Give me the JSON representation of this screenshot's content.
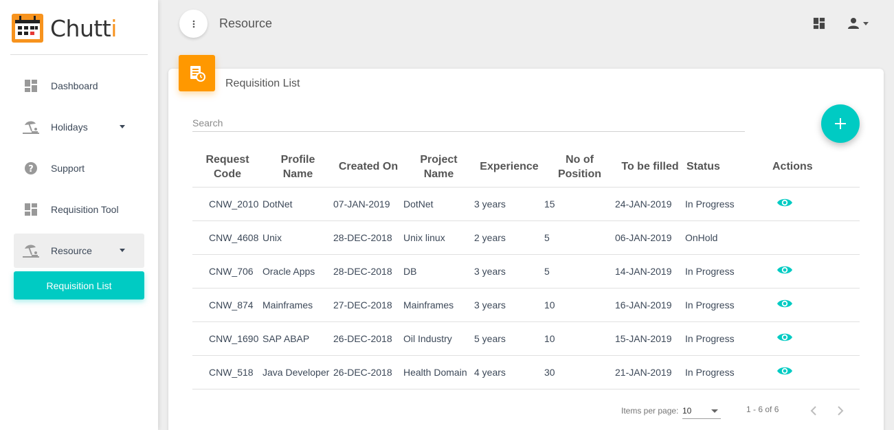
{
  "app": {
    "name_main": "Chutt",
    "name_accent": "i"
  },
  "sidebar": {
    "items": [
      {
        "label": "Dashboard",
        "icon": "dashboard-icon"
      },
      {
        "label": "Holidays",
        "icon": "beach-icon"
      },
      {
        "label": "Support",
        "icon": "help-icon"
      },
      {
        "label": "Requisition Tool",
        "icon": "dashboard-icon"
      },
      {
        "label": "Resource",
        "icon": "beach-icon"
      }
    ],
    "sub_item": "Requisition List"
  },
  "header": {
    "title": "Resource"
  },
  "card": {
    "title": "Requisition List"
  },
  "search": {
    "placeholder": "Search"
  },
  "table": {
    "headers": [
      [
        "Request",
        "Code"
      ],
      [
        "Profile",
        "Name"
      ],
      [
        "Created On"
      ],
      [
        "Project",
        "Name"
      ],
      [
        "Experience"
      ],
      [
        "No of",
        "Position"
      ],
      [
        "To be filled"
      ],
      [
        "Status"
      ],
      [
        "Actions"
      ]
    ],
    "rows": [
      {
        "code": "CNW_2010",
        "profile": "DotNet",
        "created": "07-JAN-2019",
        "project": "DotNet",
        "experience": "3 years",
        "positions": "15",
        "fill_by": "24-JAN-2019",
        "status": "In Progress",
        "view": true
      },
      {
        "code": "CNW_4608",
        "profile": "Unix",
        "created": "28-DEC-2018",
        "project": "Unix linux",
        "experience": "2 years",
        "positions": "5",
        "fill_by": "06-JAN-2019",
        "status": "OnHold",
        "view": false
      },
      {
        "code": "CNW_706",
        "profile": "Oracle Apps",
        "created": "28-DEC-2018",
        "project": "DB",
        "experience": "3 years",
        "positions": "5",
        "fill_by": "14-JAN-2019",
        "status": "In Progress",
        "view": true
      },
      {
        "code": "CNW_874",
        "profile": "Mainframes",
        "created": "27-DEC-2018",
        "project": "Mainframes",
        "experience": "3 years",
        "positions": "10",
        "fill_by": "16-JAN-2019",
        "status": "In Progress",
        "view": true
      },
      {
        "code": "CNW_1690",
        "profile": "SAP ABAP",
        "created": "26-DEC-2018",
        "project": "Oil Industry",
        "experience": "5 years",
        "positions": "10",
        "fill_by": "15-JAN-2019",
        "status": "In Progress",
        "view": true
      },
      {
        "code": "CNW_518",
        "profile": "Java Developer",
        "created": "26-DEC-2018",
        "project": "Health Domain",
        "experience": "4 years",
        "positions": "30",
        "fill_by": "21-JAN-2019",
        "status": "In Progress",
        "view": true
      }
    ]
  },
  "paginator": {
    "label": "Items per page:",
    "page_size": "10",
    "range": "1 - 6 of 6"
  },
  "colors": {
    "accent": "#00cbc3",
    "orange": "#ff9800",
    "brand_orange": "#f7931e"
  }
}
